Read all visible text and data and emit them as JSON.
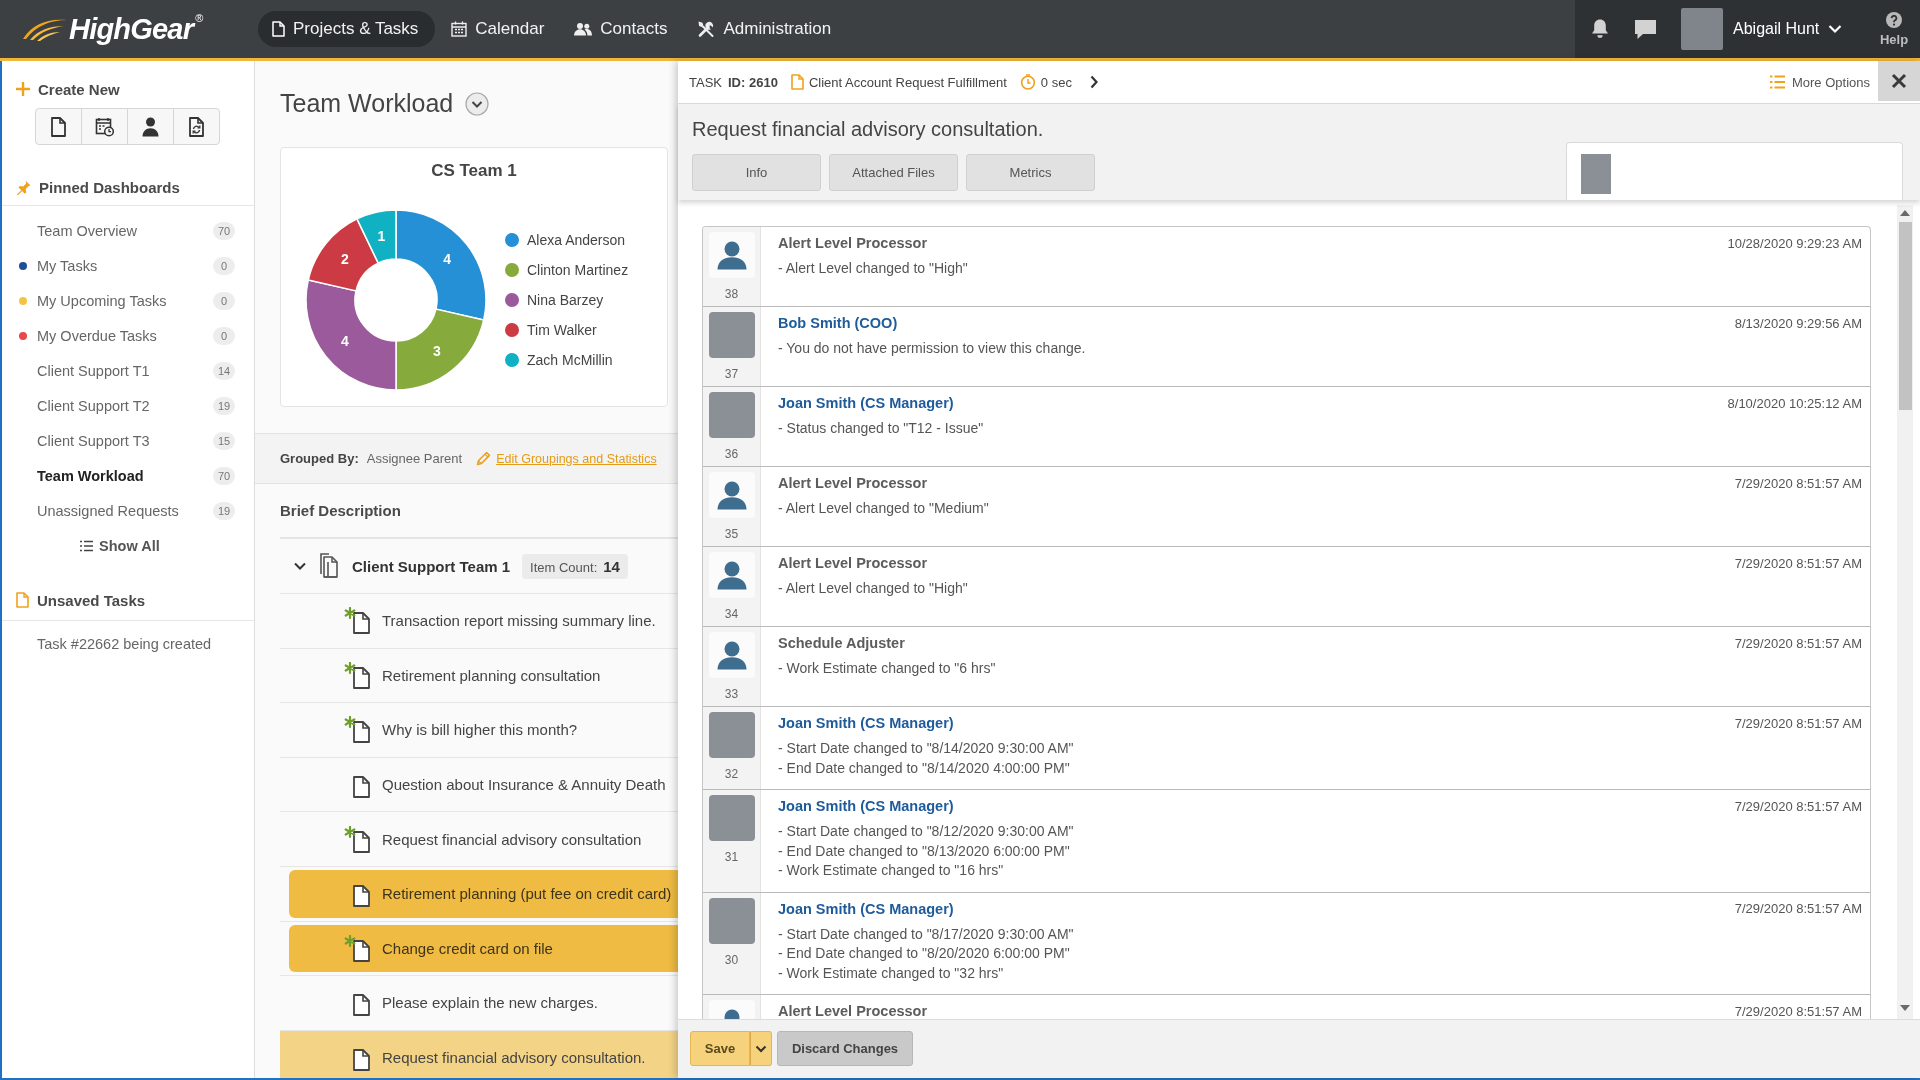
{
  "top_bar": {
    "logo": "HighGear",
    "logo_mark": "®",
    "nav": [
      {
        "label": "Projects & Tasks",
        "selected": true
      },
      {
        "label": "Calendar",
        "selected": false
      },
      {
        "label": "Contacts",
        "selected": false
      },
      {
        "label": "Administration",
        "selected": false
      }
    ],
    "user_name": "Abigail Hunt",
    "help": "Help"
  },
  "sidebar": {
    "create_new": "Create New",
    "pinned_title": "Pinned Dashboards",
    "pinned": [
      {
        "label": "Team Overview",
        "count": "70",
        "selected": false
      },
      {
        "label": "My Tasks",
        "count": "0",
        "color": "#1c4f98",
        "selected": false
      },
      {
        "label": "My Upcoming Tasks",
        "count": "0",
        "color": "#f6c244",
        "selected": false
      },
      {
        "label": "My Overdue Tasks",
        "count": "0",
        "color": "#ea4848",
        "selected": false
      },
      {
        "label": "Client Support T1",
        "count": "14",
        "selected": false
      },
      {
        "label": "Client Support T2",
        "count": "19",
        "selected": false
      },
      {
        "label": "Client Support T3",
        "count": "15",
        "selected": false
      },
      {
        "label": "Team Workload",
        "count": "70",
        "selected": true
      },
      {
        "label": "Unassigned Requests",
        "count": "19",
        "selected": false
      }
    ],
    "show_all": "Show All",
    "unsaved_title": "Unsaved Tasks",
    "unsaved": [
      "Task #22662 being created"
    ]
  },
  "dashboard": {
    "title": "Team Workload",
    "chart": {
      "chart_data": {
        "type": "donut",
        "title": "CS Team 1",
        "categories": [
          "Alexa Anderson",
          "Clinton Martinez",
          "Nina Barzey",
          "Tim Walker",
          "Zach McMillin"
        ],
        "values": [
          4,
          3,
          4,
          2,
          1
        ],
        "data_labels": true,
        "legend": "right"
      },
      "slices": [
        {
          "color": "#2590d6"
        },
        {
          "color": "#87aa3c"
        },
        {
          "color": "#9b5a9c"
        },
        {
          "color": "#cc3b44"
        },
        {
          "color": "#10b1c2"
        }
      ]
    },
    "grouped_by": {
      "label": "Grouped By:",
      "value": "Assignee Parent",
      "edit_link": "Edit Groupings and Statistics"
    },
    "column_header": "Brief Description",
    "groups": [
      {
        "name": "Client Support Team 1",
        "expanded": true,
        "count_label": "Item Count:",
        "count": "14",
        "tasks": [
          {
            "title": "Transaction report missing summary line.",
            "new": true,
            "selected": false,
            "open": false
          },
          {
            "title": "Retirement planning consultation",
            "new": true,
            "selected": false,
            "open": false
          },
          {
            "title": "Why is bill higher this month?",
            "new": true,
            "selected": false,
            "open": false
          },
          {
            "title": "Question about Insurance & Annuity Death",
            "new": false,
            "selected": false,
            "open": false
          },
          {
            "title": "Request financial advisory consultation",
            "new": true,
            "selected": false,
            "open": false
          },
          {
            "title": "Retirement planning (put fee on credit card)",
            "new": false,
            "selected": true,
            "open": false
          },
          {
            "title": "Change credit card on file",
            "new": true,
            "selected": true,
            "open": false
          },
          {
            "title": "Please explain the new charges.",
            "new": false,
            "selected": false,
            "open": false
          },
          {
            "title": "Request financial advisory consultation.",
            "new": false,
            "selected": false,
            "open": true
          }
        ]
      }
    ]
  },
  "task_panel": {
    "task_label": "TASK",
    "task_id": "ID: 2610",
    "process": "Client Account Request Fulfillment",
    "timer": "0 sec",
    "more_options": "More Options",
    "title": "Request financial advisory consultation.",
    "tabs": [
      {
        "label": "Info",
        "selected": false
      },
      {
        "label": "Attached Files",
        "selected": false
      },
      {
        "label": "Metrics",
        "selected": false
      }
    ],
    "history": [
      {
        "kind": "system",
        "author": "Alert Level Processor",
        "number": "38",
        "time": "10/28/2020 9:29:23 AM",
        "changes": [
          "- Alert Level changed to \"High\""
        ]
      },
      {
        "kind": "user",
        "author": "Bob Smith (COO)",
        "number": "37",
        "time": "8/13/2020 9:29:56 AM",
        "changes": [
          "- You do not have permission to view this change."
        ]
      },
      {
        "kind": "user",
        "author": "Joan Smith (CS Manager)",
        "number": "36",
        "time": "8/10/2020 10:25:12 AM",
        "changes": [
          "- Status changed to \"T12 - Issue\""
        ]
      },
      {
        "kind": "system",
        "author": "Alert Level Processor",
        "number": "35",
        "time": "7/29/2020 8:51:57 AM",
        "changes": [
          "- Alert Level changed to \"Medium\""
        ]
      },
      {
        "kind": "system",
        "author": "Alert Level Processor",
        "number": "34",
        "time": "7/29/2020 8:51:57 AM",
        "changes": [
          "- Alert Level changed to \"High\""
        ]
      },
      {
        "kind": "system",
        "author": "Schedule Adjuster",
        "number": "33",
        "time": "7/29/2020 8:51:57 AM",
        "changes": [
          "- Work Estimate changed to \"6 hrs\""
        ]
      },
      {
        "kind": "user",
        "author": "Joan Smith (CS Manager)",
        "number": "32",
        "time": "7/29/2020 8:51:57 AM",
        "changes": [
          "- Start Date changed to \"8/14/2020 9:30:00 AM\"",
          "- End Date changed to \"8/14/2020 4:00:00 PM\""
        ]
      },
      {
        "kind": "user",
        "author": "Joan Smith (CS Manager)",
        "number": "31",
        "time": "7/29/2020 8:51:57 AM",
        "changes": [
          "- Start Date changed to \"8/12/2020 9:30:00 AM\"",
          "- End Date changed to \"8/13/2020 6:00:00 PM\"",
          "- Work Estimate changed to \"16 hrs\""
        ]
      },
      {
        "kind": "user",
        "author": "Joan Smith (CS Manager)",
        "number": "30",
        "time": "7/29/2020 8:51:57 AM",
        "changes": [
          "- Start Date changed to \"8/17/2020 9:30:00 AM\"",
          "- End Date changed to \"8/20/2020 6:00:00 PM\"",
          "- Work Estimate changed to \"32 hrs\""
        ]
      },
      {
        "kind": "system",
        "author": "Alert Level Processor",
        "time": "7/29/2020 8:51:57 AM"
      }
    ],
    "save": "Save",
    "discard": "Discard Changes"
  }
}
